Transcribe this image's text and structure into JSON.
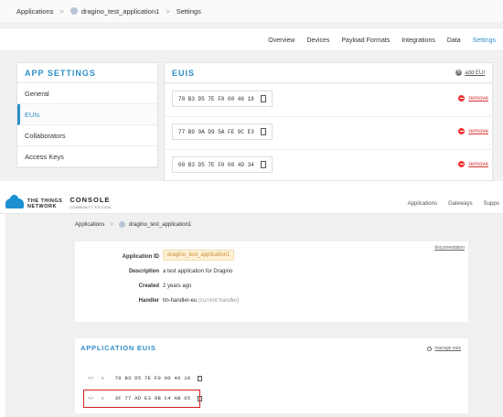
{
  "top": {
    "breadcrumb": {
      "applications": "Applications",
      "application": "dragino_test_application1",
      "settings": "Settings"
    },
    "tabs": [
      "Overview",
      "Devices",
      "Payload Formats",
      "Integrations",
      "Data",
      "Settings"
    ],
    "active_tab": "Settings",
    "app_settings": {
      "title": "APP SETTINGS",
      "items": [
        "General",
        "EUIs",
        "Collaborators",
        "Access Keys"
      ],
      "active_item": "EUIs"
    },
    "euis": {
      "title": "EUIS",
      "add_label": "add EUI",
      "remove_label": "remove",
      "values": [
        "70 B3 D5 7E F0 00 46 18",
        "77 B9 9A D9 5A FE 9C E3",
        "00 B3 D5 7E F0 00 4D 34"
      ]
    }
  },
  "bottom": {
    "header": {
      "logo_line1": "THE THINGS",
      "logo_line2": "NETWORK",
      "console": "CONSOLE",
      "console_sub": "COMMUNITY EDITION",
      "nav": [
        "Applications",
        "Gateways",
        "Suppo"
      ]
    },
    "breadcrumb": {
      "applications": "Applications",
      "application": "dragino_test_application1"
    },
    "overview": {
      "documentation": "documentation",
      "app_id_label": "Application ID",
      "app_id_value": "dragino_test_application1",
      "description_label": "Description",
      "description_value": "a test application for Dragino",
      "created_label": "Created",
      "created_value": "2 years ago",
      "handler_label": "Handler",
      "handler_value": "ttn-handler-eu",
      "handler_note": "(current handler)"
    },
    "app_euis": {
      "title": "APPLICATION EUIS",
      "manage_label": "manage euis",
      "code_icon": "<>",
      "equals_icon": "≡",
      "values": [
        "70 B3 D5 7E F0 00 46 18",
        "3F 77 AD E3 9B C4 AB 65"
      ]
    }
  },
  "colors": {
    "accent": "#2f8ec8",
    "remove": "#dd3333",
    "highlight_border": "#d42020",
    "badge_bg": "#fdf0d5"
  }
}
